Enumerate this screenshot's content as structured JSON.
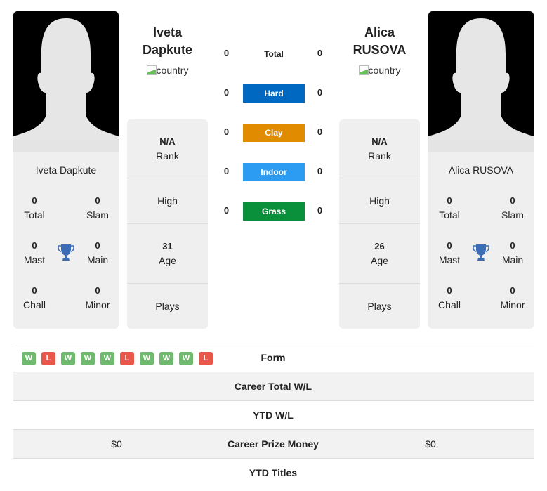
{
  "colors": {
    "hard": "#0068c0",
    "clay": "#e08b00",
    "indoor": "#2b9cf2",
    "grass": "#0a8f3a",
    "win": "#6fba6f",
    "loss": "#e8584a",
    "trophy": "#3b6cb5"
  },
  "player1": {
    "first_name": "Iveta",
    "last_name": "Dapkute",
    "full_name": "Iveta Dapkute",
    "country_alt": "country",
    "titles": {
      "total": "0",
      "slam": "0",
      "mast": "0",
      "main": "0",
      "chall": "0",
      "minor": "0"
    },
    "rank": "N/A",
    "high": "",
    "age": "31",
    "plays": ""
  },
  "player2": {
    "first_name": "Alica",
    "last_name": "RUSOVA",
    "full_name": "Alica RUSOVA",
    "country_alt": "country",
    "titles": {
      "total": "0",
      "slam": "0",
      "mast": "0",
      "main": "0",
      "chall": "0",
      "minor": "0"
    },
    "rank": "N/A",
    "high": "",
    "age": "26",
    "plays": ""
  },
  "labels": {
    "total": "Total",
    "slam": "Slam",
    "mast": "Mast",
    "main": "Main",
    "chall": "Chall",
    "minor": "Minor",
    "rank": "Rank",
    "high": "High",
    "age": "Age",
    "plays": "Plays"
  },
  "surfaces": [
    {
      "name": "Total",
      "p1": "0",
      "p2": "0"
    },
    {
      "name": "Hard",
      "p1": "0",
      "p2": "0"
    },
    {
      "name": "Clay",
      "p1": "0",
      "p2": "0"
    },
    {
      "name": "Indoor",
      "p1": "0",
      "p2": "0"
    },
    {
      "name": "Grass",
      "p1": "0",
      "p2": "0"
    }
  ],
  "form": [
    "W",
    "L",
    "W",
    "W",
    "W",
    "L",
    "W",
    "W",
    "W",
    "L"
  ],
  "table": [
    {
      "label": "Form",
      "p1": "",
      "p2": ""
    },
    {
      "label": "Career Total W/L",
      "p1": "",
      "p2": ""
    },
    {
      "label": "YTD W/L",
      "p1": "",
      "p2": ""
    },
    {
      "label": "Career Prize Money",
      "p1": "$0",
      "p2": "$0"
    },
    {
      "label": "YTD Titles",
      "p1": "",
      "p2": ""
    }
  ]
}
